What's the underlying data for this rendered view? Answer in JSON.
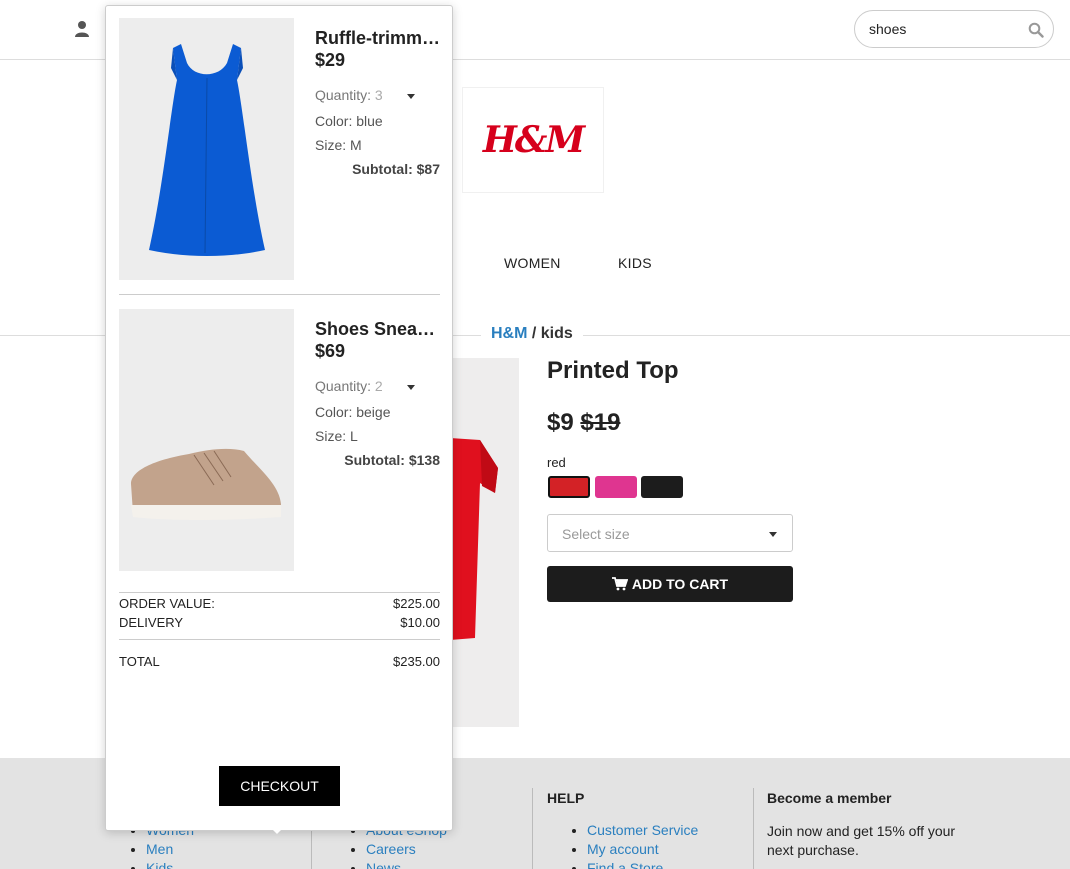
{
  "header": {
    "search_value": "shoes"
  },
  "brand": {
    "logo_text": "H&M"
  },
  "nav": {
    "items": [
      "WOMEN",
      "KIDS"
    ]
  },
  "breadcrumb": {
    "root": "H&M",
    "separator": " / ",
    "current": "kids"
  },
  "product": {
    "title": "Printed Top",
    "price": "$9",
    "old_price": "$19",
    "selected_color": "red",
    "swatches": [
      "#d32226",
      "#df3590",
      "#1c1c1c"
    ],
    "size_placeholder": "Select size",
    "add_to_cart_label": "ADD TO CART"
  },
  "cart": {
    "items": [
      {
        "name": "Ruffle-trimmed Dress",
        "price": "$29",
        "quantity_label": "Quantity:",
        "quantity": "3",
        "color": "Color: blue",
        "size": "Size: M",
        "subtotal": "Subtotal: $87"
      },
      {
        "name": "Shoes Sneakers",
        "price": "$69",
        "quantity_label": "Quantity:",
        "quantity": "2",
        "color": "Color: beige",
        "size": "Size: L",
        "subtotal": "Subtotal: $138"
      }
    ],
    "order_value_label": "ORDER VALUE:",
    "order_value": "$225.00",
    "delivery_label": "DELIVERY",
    "delivery": "$10.00",
    "total_label": "TOTAL",
    "total": "$235.00",
    "checkout_label": "CHECKOUT"
  },
  "footer": {
    "col1_links": [
      "Women",
      "Men",
      "Kids"
    ],
    "col2_links": [
      "About eShop",
      "Careers",
      "News"
    ],
    "help_heading": "HELP",
    "help_links": [
      "Customer Service",
      "My account",
      "Find a Store"
    ],
    "member_heading": "Become a member",
    "member_text": "Join now and get 15% off your next purchase."
  },
  "colors": {
    "link": "#2a7fbf",
    "brand_red": "#d6001c",
    "button_dark": "#1c1c1c"
  }
}
